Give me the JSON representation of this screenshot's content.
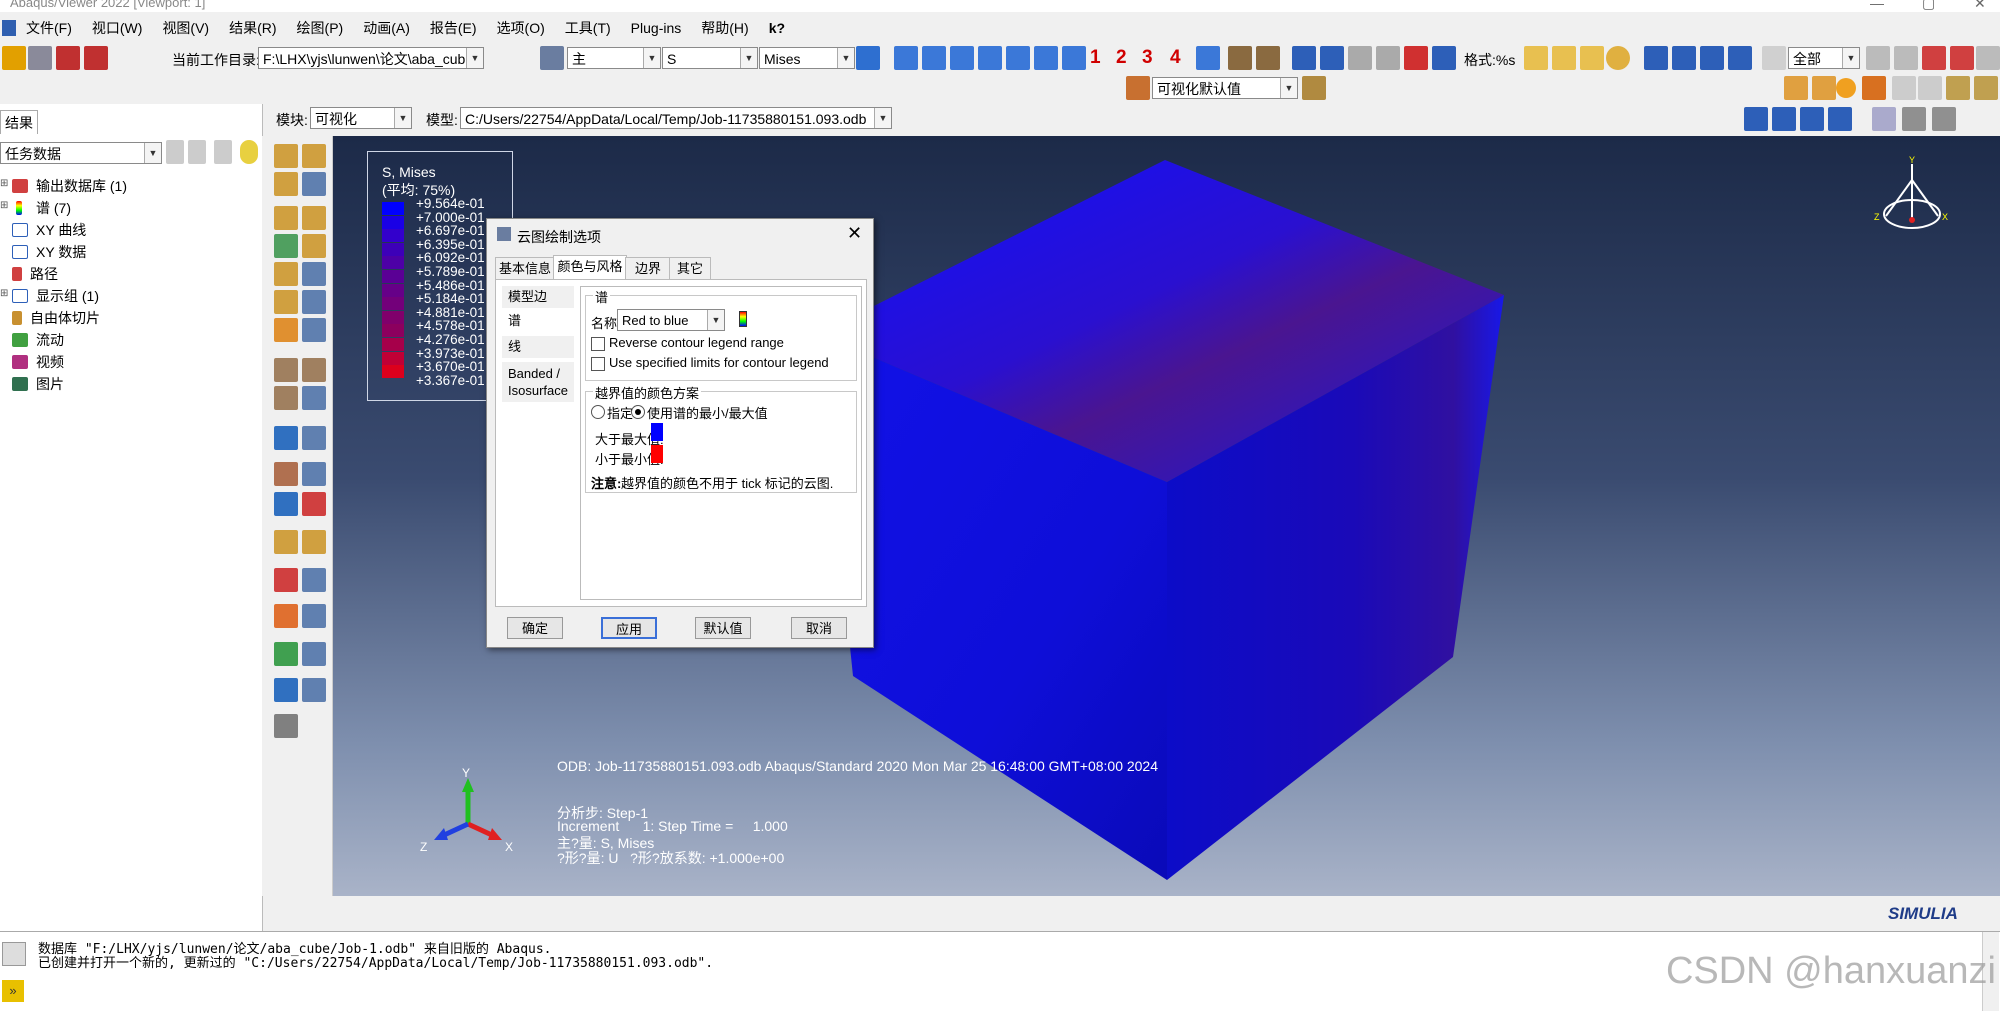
{
  "window": {
    "title": "Abaqus/Viewer 2022 [Viewport: 1]"
  },
  "menu": [
    "文件(F)",
    "视口(W)",
    "视图(V)",
    "结果(R)",
    "绘图(P)",
    "动画(A)",
    "报告(E)",
    "选项(O)",
    "工具(T)",
    "Plug-ins",
    "帮助(H)",
    "k?"
  ],
  "toolbar": {
    "workdir_label": "当前工作目录:",
    "workdir_value": "F:\\LHX\\yjs\\lunwen\\论文\\aba_cube",
    "primary_select": "主",
    "field_select": "S",
    "invariant_select": "Mises",
    "frame_numbers": [
      "1",
      "2",
      "3",
      "4"
    ],
    "format_label": "格式:%s",
    "select_all": "全部",
    "viz_defaults": "可视化默认值"
  },
  "module": {
    "label": "模块:",
    "value": "可视化",
    "model_label": "模型:",
    "model_value": "C:/Users/22754/AppData/Local/Temp/Job-11735880151.093.odb"
  },
  "left_panel": {
    "tab": "结果",
    "filter": "任务数据",
    "tree": [
      "输出数据库 (1)",
      "谱 (7)",
      "XY 曲线",
      "XY 数据",
      "路径",
      "显示组 (1)",
      "自由体切片",
      "流动",
      "视频",
      "图片"
    ]
  },
  "legend": {
    "title": "S, Mises",
    "subtitle": "(平均: 75%)",
    "values": [
      "+9.564e-01",
      "+7.000e-01",
      "+6.697e-01",
      "+6.395e-01",
      "+6.092e-01",
      "+5.789e-01",
      "+5.486e-01",
      "+5.184e-01",
      "+4.881e-01",
      "+4.578e-01",
      "+4.276e-01",
      "+3.973e-01",
      "+3.670e-01",
      "+3.367e-01"
    ],
    "colors": [
      "#0000ff",
      "#1a00e5",
      "#3300cc",
      "#3d00b8",
      "#4d00a6",
      "#5a0095",
      "#660088",
      "#73007a",
      "#80006b",
      "#8c005e",
      "#a6004a",
      "#c00035",
      "#dc001c",
      "#ff0000"
    ]
  },
  "viewport_info": {
    "odb_line": "ODB: Job-11735880151.093.odb     Abaqus/Standard 2020     Mon Mar 25 16:48:00 GMT+08:00 2024",
    "step": "分析步: Step-1",
    "increment": "Increment      1: Step Time =     1.000",
    "primary_var": "主?量: S, Mises",
    "deformed_var": "?形?量: U   ?形?放系数: +1.000e+00",
    "axis_x": "X",
    "axis_y": "Y",
    "axis_z": "Z",
    "brand": "SIMULIA"
  },
  "dialog": {
    "title": "云图绘制选项",
    "tabs": [
      "基本信息",
      "颜色与风格",
      "边界",
      "其它"
    ],
    "side_tabs": [
      "模型边",
      "谱",
      "线",
      "Banded / Isosurface"
    ],
    "spectrum_group": "谱",
    "name_label": "名称:",
    "name_value": "Red to blue",
    "reverse_label": "Reverse contour legend range",
    "limits_label": "Use specified limits for contour legend",
    "outlimit_group": "越界值的颜色方案",
    "radio_specify": "指定",
    "radio_use": "使用谱的最小/最大值",
    "above_label": "大于最大值:",
    "below_label": "小于最小值:",
    "above_color": "#0000ff",
    "below_color": "#ff0000",
    "note_label": "注意:",
    "note_text": "越界值的颜色不用于 tick 标记的云图.",
    "buttons": [
      "确定",
      "应用",
      "默认值",
      "取消"
    ]
  },
  "messages": [
    "数据库 \"F:/LHX/yjs/lunwen/论文/aba_cube/Job-1.odb\" 来自旧版的 Abaqus.",
    "已创建并打开一个新的, 更新过的 \"C:/Users/22754/AppData/Local/Temp/Job-11735880151.093.odb\"."
  ],
  "watermark": "CSDN @hanxuanzi"
}
